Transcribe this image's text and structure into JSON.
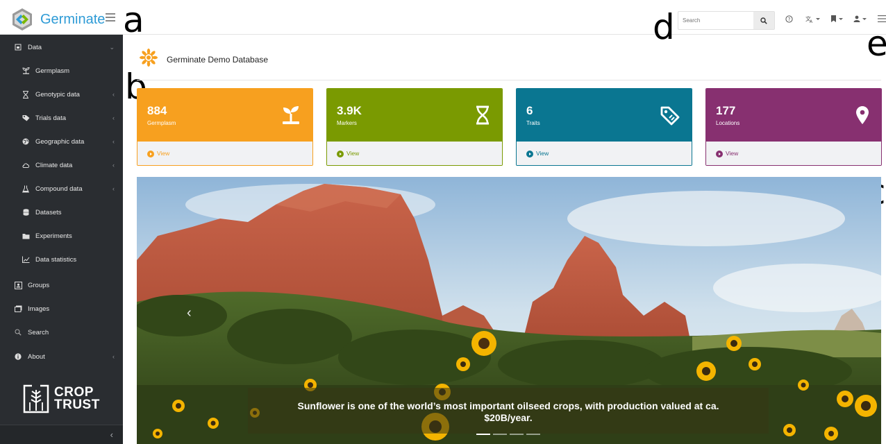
{
  "header": {
    "app_name": "Germinate",
    "search_placeholder": "Search"
  },
  "figure_labels": {
    "a": "a",
    "b": "b",
    "c": "c",
    "d": "d",
    "e": "e"
  },
  "sidebar": {
    "items": [
      {
        "label": "Data",
        "level": "top",
        "icon": "database-icon",
        "chevron": "⌄"
      },
      {
        "label": "Germplasm",
        "level": "sub",
        "icon": "sprout-icon"
      },
      {
        "label": "Genotypic data",
        "level": "sub",
        "icon": "dna-icon",
        "chevron": "‹"
      },
      {
        "label": "Trials data",
        "level": "sub",
        "icon": "tag-icon",
        "chevron": "‹"
      },
      {
        "label": "Geographic data",
        "level": "sub",
        "icon": "globe-icon",
        "chevron": "‹"
      },
      {
        "label": "Climate data",
        "level": "sub",
        "icon": "cloud-icon",
        "chevron": "‹"
      },
      {
        "label": "Compound data",
        "level": "sub",
        "icon": "flask-icon",
        "chevron": "‹"
      },
      {
        "label": "Datasets",
        "level": "sub",
        "icon": "stack-icon"
      },
      {
        "label": "Experiments",
        "level": "sub",
        "icon": "folder-icon"
      },
      {
        "label": "Data statistics",
        "level": "sub",
        "icon": "chart-icon"
      },
      {
        "label": "Groups",
        "level": "top",
        "icon": "group-icon"
      },
      {
        "label": "Images",
        "level": "top",
        "icon": "images-icon"
      },
      {
        "label": "Search",
        "level": "top",
        "icon": "search-icon"
      },
      {
        "label": "About",
        "level": "top",
        "icon": "info-icon",
        "chevron": "‹"
      }
    ],
    "partner_logo": {
      "line1": "CROP",
      "line2": "TRUST"
    },
    "collapse_symbol": "‹"
  },
  "main": {
    "title": "Germinate Demo Database",
    "stats": [
      {
        "value": "884",
        "label": "Germplasm",
        "view": "View",
        "color": "#f7a01f",
        "icon": "sprout-icon"
      },
      {
        "value": "3.9K",
        "label": "Markers",
        "view": "View",
        "color": "#7a9a01",
        "icon": "dna-icon"
      },
      {
        "value": "6",
        "label": "Traits",
        "view": "View",
        "color": "#0a7691",
        "icon": "tag-icon"
      },
      {
        "value": "177",
        "label": "Locations",
        "view": "View",
        "color": "#873070",
        "icon": "map-pin-icon"
      }
    ],
    "carousel": {
      "caption": "Sunflower is one of the world’s most important oilseed crops, with production valued at ca. $20B/year.",
      "prev_symbol": "‹",
      "slide_count": 4,
      "active_slide": 1
    }
  }
}
